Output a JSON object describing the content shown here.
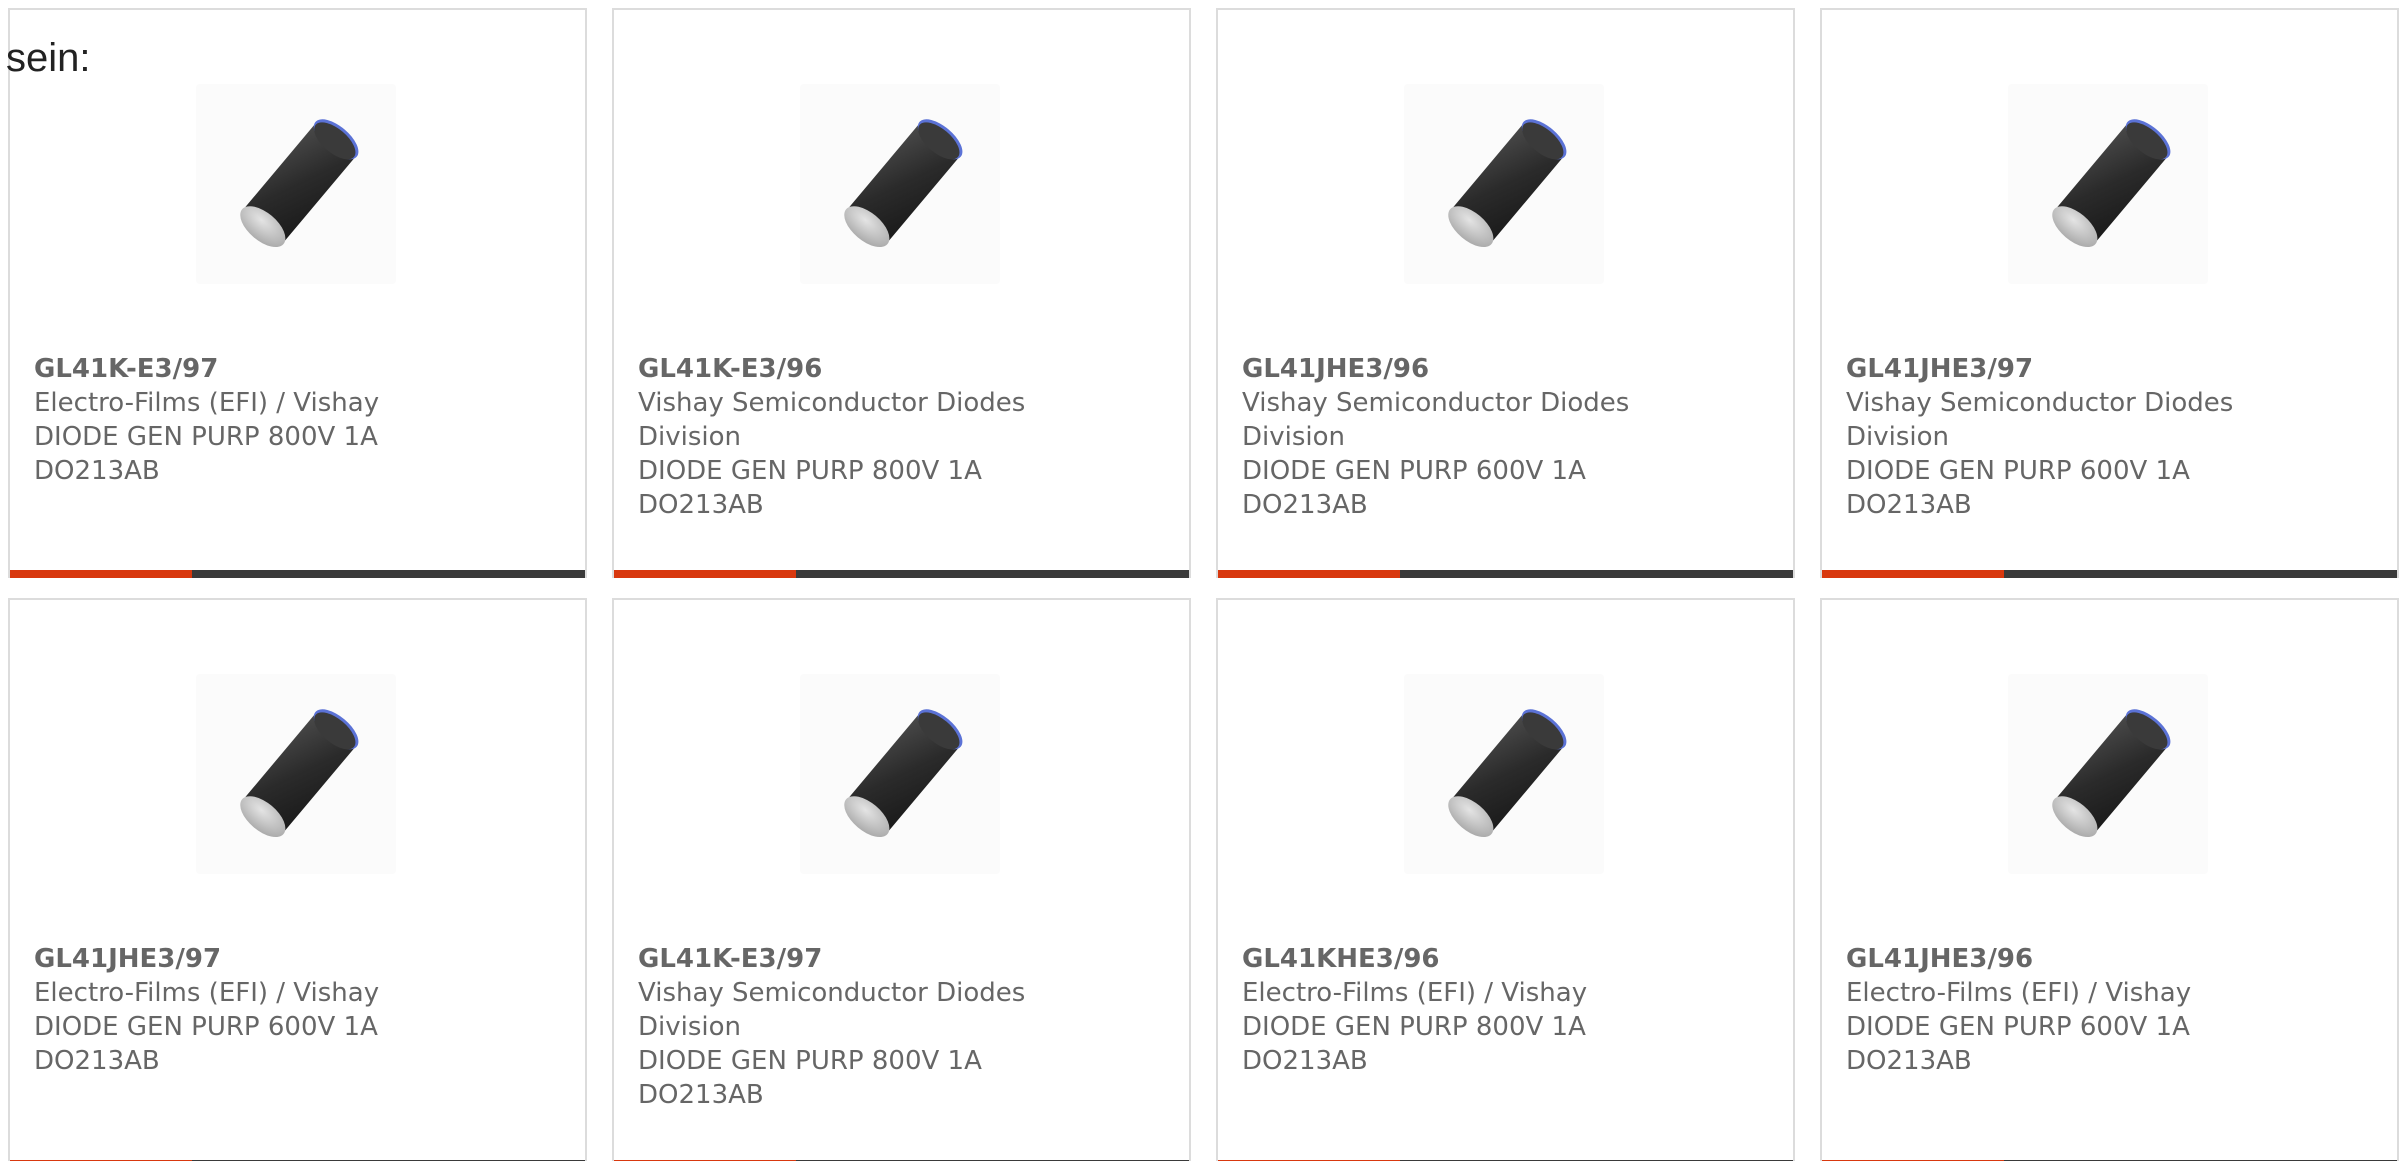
{
  "intro_text": "sein:",
  "colors": {
    "accent": "#d8380e",
    "bar": "#3a3a3a",
    "text": "#666666",
    "border": "#dcdcdc"
  },
  "product_icon": "diode-cylinder-icon",
  "products": [
    {
      "part_number": "GL41K-E3/97",
      "manufacturer": "Electro-Films (EFI) / Vishay",
      "description": "DIODE GEN PURP 800V 1A",
      "package": "DO213AB"
    },
    {
      "part_number": "GL41K-E3/96",
      "manufacturer": "Vishay Semiconductor Diodes Division",
      "description": "DIODE GEN PURP 800V 1A",
      "package": "DO213AB"
    },
    {
      "part_number": "GL41JHE3/96",
      "manufacturer": "Vishay Semiconductor Diodes Division",
      "description": "DIODE GEN PURP 600V 1A",
      "package": "DO213AB"
    },
    {
      "part_number": "GL41JHE3/97",
      "manufacturer": "Vishay Semiconductor Diodes Division",
      "description": "DIODE GEN PURP 600V 1A",
      "package": "DO213AB"
    },
    {
      "part_number": "GL41JHE3/97",
      "manufacturer": "Electro-Films (EFI) / Vishay",
      "description": "DIODE GEN PURP 600V 1A",
      "package": "DO213AB"
    },
    {
      "part_number": "GL41K-E3/97",
      "manufacturer": "Vishay Semiconductor Diodes Division",
      "description": "DIODE GEN PURP 800V 1A",
      "package": "DO213AB"
    },
    {
      "part_number": "GL41KHE3/96",
      "manufacturer": "Electro-Films (EFI) / Vishay",
      "description": "DIODE GEN PURP 800V 1A",
      "package": "DO213AB"
    },
    {
      "part_number": "GL41JHE3/96",
      "manufacturer": "Electro-Films (EFI) / Vishay",
      "description": "DIODE GEN PURP 600V 1A",
      "package": "DO213AB"
    }
  ]
}
